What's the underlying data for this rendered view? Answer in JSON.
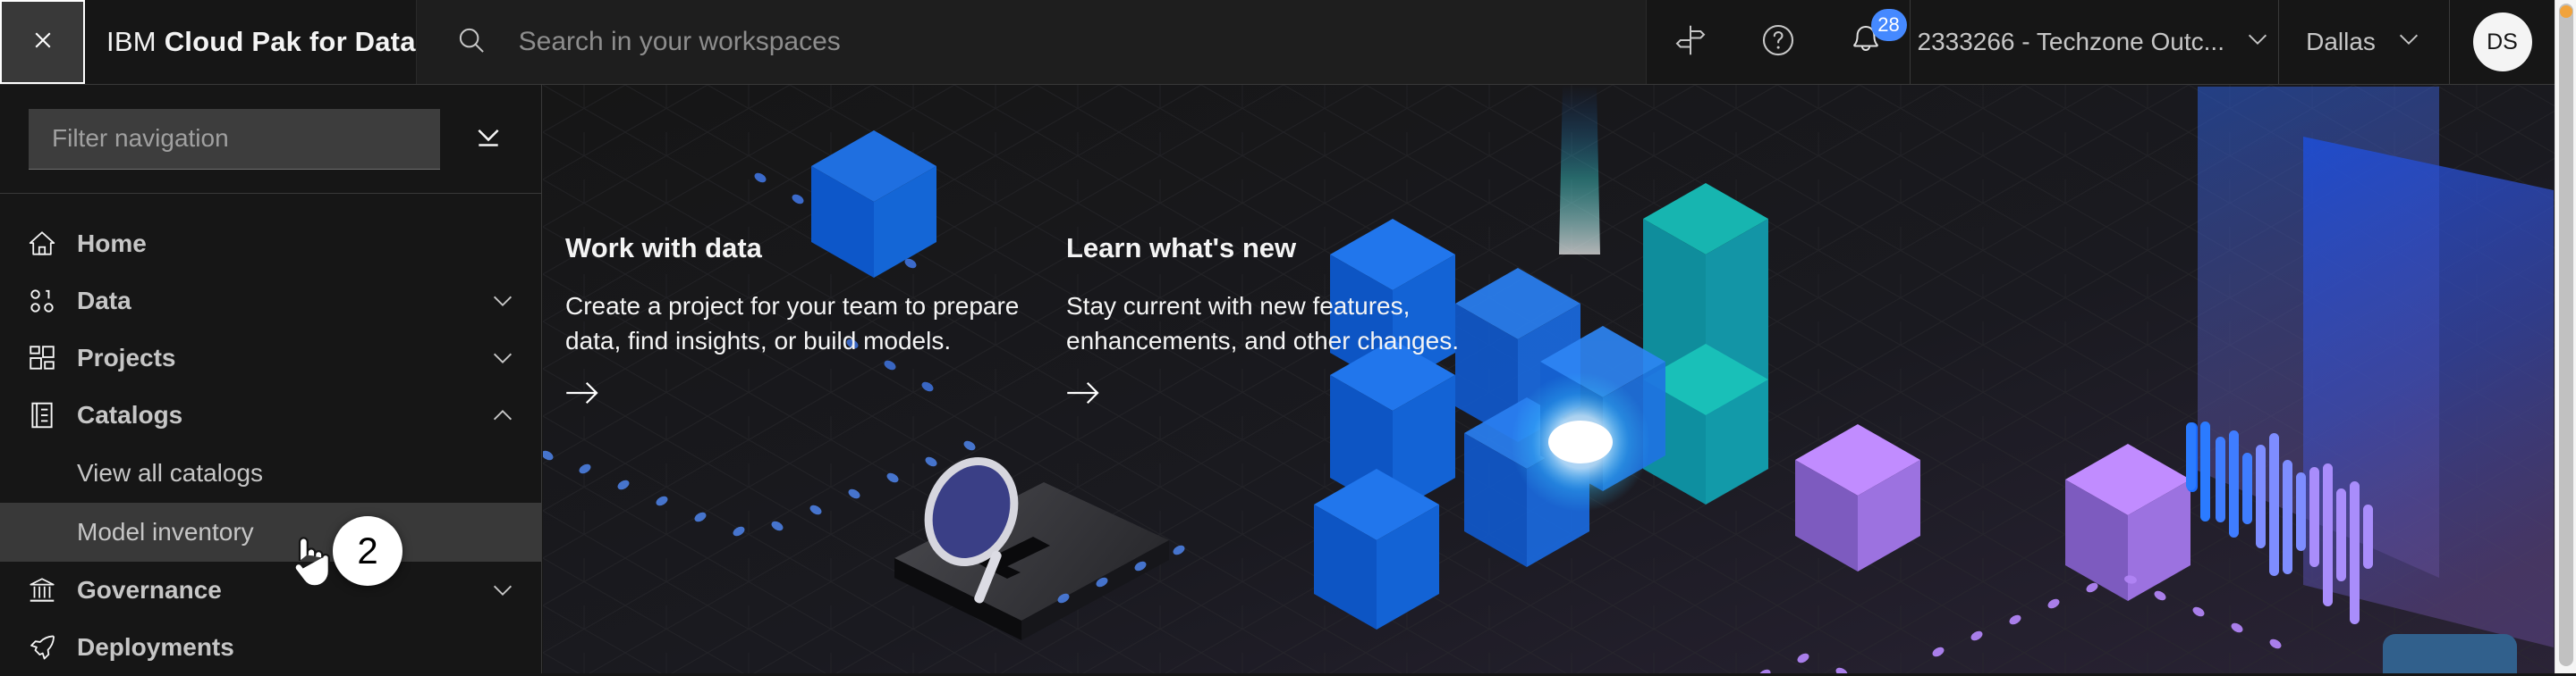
{
  "header": {
    "close_icon": "close-icon",
    "brand_prefix": "IBM",
    "brand_name": "Cloud Pak for Data",
    "search_placeholder": "Search in your workspaces",
    "search_icon": "search-icon",
    "signpost_icon": "signpost-icon",
    "help_icon": "help-circle-icon",
    "notifications_icon": "bell-icon",
    "notifications_count": "28",
    "account": "2333266 - Techzone Outc...",
    "account_chevron": "chevron-down-icon",
    "region": "Dallas",
    "region_chevron": "chevron-down-icon",
    "avatar_initials": "DS"
  },
  "sidebar": {
    "filter_placeholder": "Filter navigation",
    "filter_value": "",
    "collapse_all_icon": "collapse-all-icon",
    "items": [
      {
        "label": "Home",
        "icon": "home-icon",
        "expandable": false,
        "chevron": ""
      },
      {
        "label": "Data",
        "icon": "data-icon",
        "expandable": true,
        "chevron": "chevron-down-icon"
      },
      {
        "label": "Projects",
        "icon": "projects-icon",
        "expandable": true,
        "chevron": "chevron-down-icon"
      },
      {
        "label": "Catalogs",
        "icon": "catalogs-icon",
        "expandable": true,
        "chevron": "chevron-up-icon"
      },
      {
        "label": "Governance",
        "icon": "governance-icon",
        "expandable": true,
        "chevron": "chevron-down-icon"
      },
      {
        "label": "Deployments",
        "icon": "deployments-icon",
        "expandable": false,
        "chevron": ""
      }
    ],
    "catalogs_children": [
      {
        "label": "View all catalogs",
        "active": false
      },
      {
        "label": "Model inventory",
        "active": true
      }
    ]
  },
  "main": {
    "cards": [
      {
        "title": "Work with data",
        "body": "Create a project for your team to prepare data, find insights, or build models.",
        "arrow_icon": "arrow-right-icon"
      },
      {
        "title": "Learn what's new",
        "body": "Stay current with new features, enhancements, and other changes.",
        "arrow_icon": "arrow-right-icon"
      }
    ]
  },
  "annotation": {
    "step_number": "2",
    "cursor_icon": "pointing-hand-cursor"
  },
  "colors": {
    "page_bg": "#161616",
    "header_bg": "#161616",
    "sidebar_active": "#393939",
    "accent_blue": "#4589ff",
    "cube_blue": "#0f62fe",
    "cube_teal": "#08bdba",
    "cube_purple": "#a56eff",
    "scrollbar_dot": "#f1a33c",
    "chat_widget": "#31608c"
  }
}
